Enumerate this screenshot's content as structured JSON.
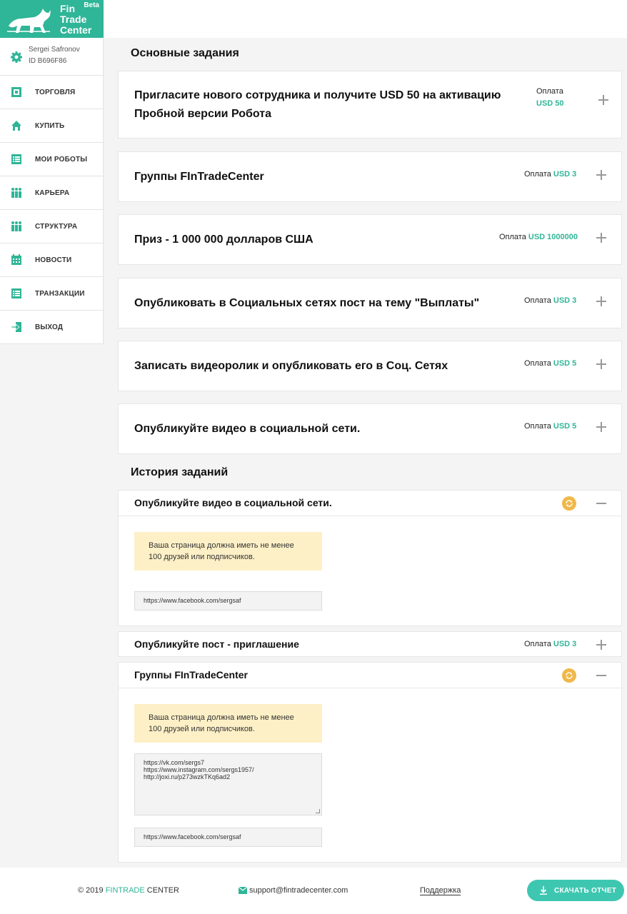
{
  "brand": {
    "line1": "Fin",
    "line2": "Trade",
    "line3": "Center",
    "beta": "Beta",
    "color": "#2fb597"
  },
  "user": {
    "name": "Sergei Safronov",
    "id": "ID B696F86"
  },
  "nav": [
    {
      "label": "ТОРГОВЛЯ",
      "icon": "trading-icon"
    },
    {
      "label": "КУПИТЬ",
      "icon": "home-icon"
    },
    {
      "label": "МОИ РОБОТЫ",
      "icon": "list-icon"
    },
    {
      "label": "КАРЬЕРА",
      "icon": "people-icon"
    },
    {
      "label": "СТРУКТУРА",
      "icon": "people-icon"
    },
    {
      "label": "НОВОСТИ",
      "icon": "calendar-icon"
    },
    {
      "label": "ТРАНЗАКЦИИ",
      "icon": "list-icon"
    },
    {
      "label": "ВЫХОД",
      "icon": "logout-icon"
    }
  ],
  "main_tasks": {
    "title": "Основные задания",
    "items": [
      {
        "title_line1": "Пригласите нового сотрудника и получите USD 50 на активацию",
        "title_line2": "Пробной версии Робота",
        "pay_label": "Оплата",
        "pay_amount": "USD 50"
      },
      {
        "title": "Группы FInTradeCenter",
        "pay_label": "Оплата",
        "pay_amount": "USD 3"
      },
      {
        "title": "Приз - 1 000 000 долларов США",
        "pay_label": "Оплата",
        "pay_amount": "USD 1000000"
      },
      {
        "title": "Опубликовать в Социальных сетях пост на тему \"Выплаты\"",
        "pay_label": "Оплата",
        "pay_amount": "USD 3"
      },
      {
        "title": "Записать видеоролик и опубликовать его в Соц. Сетях",
        "pay_label": "Оплата",
        "pay_amount": "USD 5"
      },
      {
        "title": "Опубликуйте видео в социальной сети.",
        "pay_label": "Оплата",
        "pay_amount": "USD 5"
      }
    ]
  },
  "history": {
    "title": "История заданий",
    "items": [
      {
        "title": "Опубликуйте видео в социальной сети.",
        "notice": "Ваша страница должна иметь не менее 100 друзей или подписчиков.",
        "link": "https://www.facebook.com/sergsaf"
      },
      {
        "title": "Опубликуйте пост - приглашение",
        "pay_label": "Оплата",
        "pay_amount": "USD 3"
      },
      {
        "title": "Группы FInTradeCenter",
        "notice": "Ваша страница должна иметь не менее 100 друзей или подписчиков.",
        "textarea_lines": [
          "https://vk.com/sergs7",
          "https://www.instagram.com/sergs1957/",
          "http://joxi.ru/p273wzkTKq6ad2"
        ],
        "link": "https://www.facebook.com/sergsaf"
      }
    ]
  },
  "footer": {
    "copy_prefix": "© 2019 ",
    "copy_brand": "FINTRADE",
    "copy_suffix": " CENTER",
    "email": "support@fintradecenter.com",
    "support": "Поддержка",
    "download": "СКАЧАТЬ ОТЧЕТ"
  }
}
